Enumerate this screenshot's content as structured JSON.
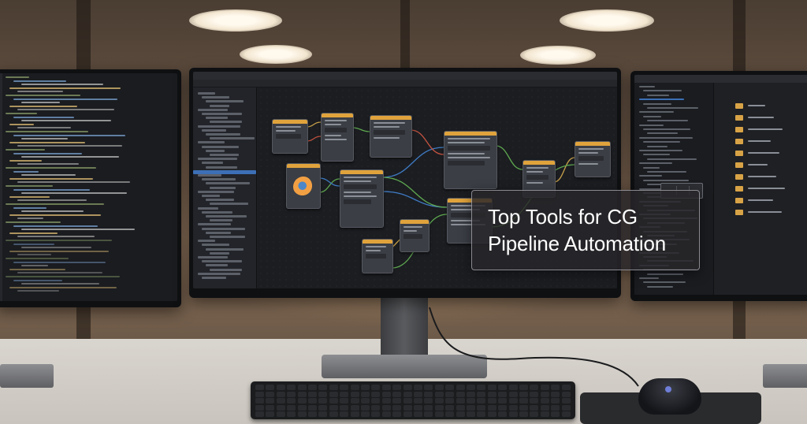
{
  "overlay": {
    "title_line1": "Top Tools for CG",
    "title_line2": "Pipeline Automation"
  },
  "scene": {
    "center_app": "node-graph-editor",
    "left_app": "code-editor",
    "right_app": "file-browser",
    "node_header_color": "#e0a33c",
    "selection_color": "#3c6fb5",
    "accent_glow": "#6f7ed8"
  }
}
